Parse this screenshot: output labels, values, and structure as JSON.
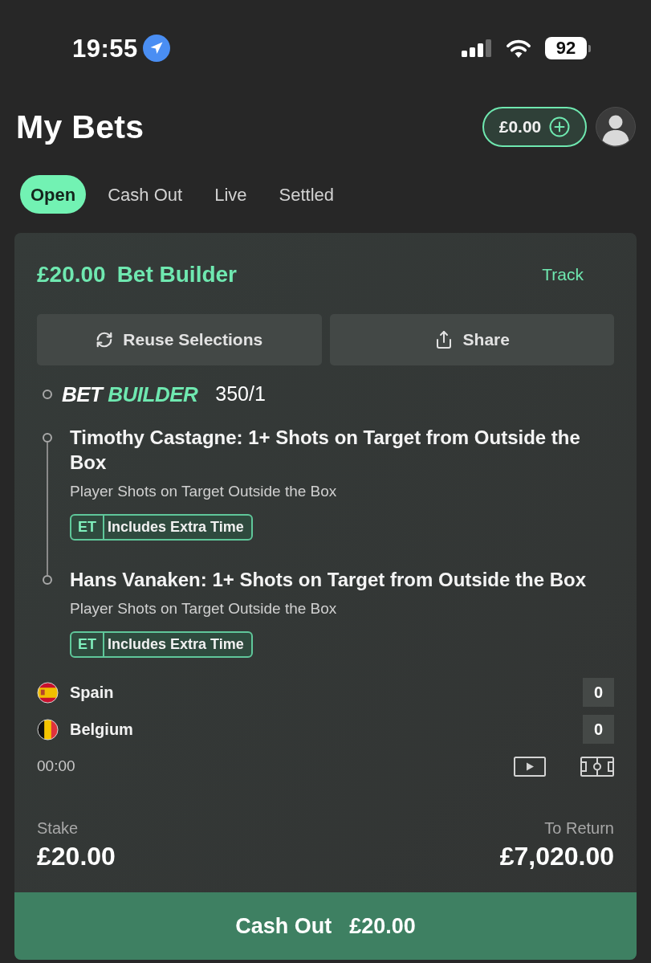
{
  "status_bar": {
    "time": "19:55",
    "battery": "92"
  },
  "header": {
    "title": "My Bets",
    "balance": "£0.00"
  },
  "tabs": [
    {
      "label": "Open",
      "selected": true
    },
    {
      "label": "Cash Out",
      "selected": false
    },
    {
      "label": "Live",
      "selected": false
    },
    {
      "label": "Settled",
      "selected": false
    }
  ],
  "bet": {
    "stake_amount": "£20.00",
    "type": "Bet Builder",
    "track": "Track",
    "actions": [
      {
        "label": "Reuse Selections",
        "kind": "reuse"
      },
      {
        "label": "Share",
        "kind": "share"
      }
    ],
    "builder_label": {
      "part_1": "BET",
      "part_2": "BUILDER"
    },
    "odds": "350/1",
    "legs": [
      {
        "selection": "Timothy Castagne: 1+ Shots on Target from Outside the Box",
        "market": "Player Shots on Target Outside the Box",
        "badge_code": "ET",
        "badge_text": "Includes Extra Time"
      },
      {
        "selection": "Hans Vanaken: 1+ Shots on Target from Outside the Box",
        "market": "Player Shots on Target Outside the Box",
        "badge_code": "ET",
        "badge_text": "Includes Extra Time"
      }
    ],
    "teams": [
      {
        "name": "Spain",
        "score": "0",
        "kind": "spain"
      },
      {
        "name": "Belgium",
        "score": "0",
        "kind": "belgium"
      }
    ],
    "clock": "00:00",
    "stake_label": "Stake",
    "stake": "£20.00",
    "return_label": "To Return",
    "return": "£7,020.00",
    "cash_out": {
      "label": "Cash Out",
      "amount": "£20.00"
    }
  }
}
